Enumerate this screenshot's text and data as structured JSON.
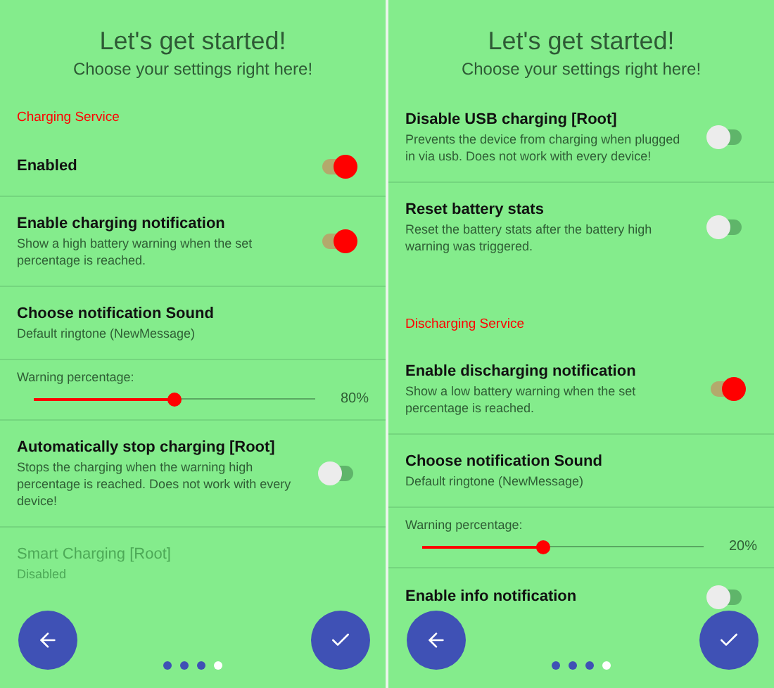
{
  "screens": [
    {
      "title": "Let's get started!",
      "subtitle": "Choose your settings right here!",
      "items": [
        {
          "kind": "header",
          "title": "Charging Service"
        },
        {
          "kind": "switch",
          "title": "Enabled",
          "on": true
        },
        {
          "kind": "switch",
          "title": "Enable charging notification",
          "subtitle": "Show a high battery warning when the set percentage is reached.",
          "on": true
        },
        {
          "kind": "text",
          "title": "Choose notification Sound",
          "subtitle": "Default ringtone (NewMessage)",
          "disabled": false
        },
        {
          "kind": "slider",
          "title": "Warning percentage:",
          "level": 0.5,
          "reading": "80%"
        },
        {
          "kind": "switch",
          "title": "Automatically stop charging [Root]",
          "subtitle": "Stops the charging when the warning high percentage is reached. Does not work with every device!",
          "on": false
        },
        {
          "kind": "text",
          "title": "Smart Charging [Root]",
          "subtitle": "Disabled",
          "disabled": true
        }
      ],
      "dots": [
        {
          "selected": false
        },
        {
          "selected": false
        },
        {
          "selected": false
        },
        {
          "selected": true
        }
      ]
    },
    {
      "title": "Let's get started!",
      "subtitle": "Choose your settings right here!",
      "items": [
        {
          "kind": "switch",
          "title": "Disable USB charging [Root]",
          "subtitle": "Prevents the device from charging when plugged in via usb. Does not work with every device!",
          "on": false
        },
        {
          "kind": "switch",
          "title": "Reset battery stats",
          "subtitle": "Reset the battery stats after the battery high warning was triggered.",
          "on": false
        },
        {
          "kind": "header",
          "title": "Discharging Service"
        },
        {
          "kind": "switch",
          "title": "Enable discharging notification",
          "subtitle": "Show a low battery warning when the set percentage is reached.",
          "on": true
        },
        {
          "kind": "text",
          "title": "Choose notification Sound",
          "subtitle": "Default ringtone (NewMessage)",
          "disabled": false
        },
        {
          "kind": "slider",
          "title": "Warning percentage:",
          "level": 0.43,
          "reading": "20%"
        },
        {
          "kind": "switch",
          "title": "Enable info notification",
          "on": false
        }
      ],
      "dots": [
        {
          "selected": false
        },
        {
          "selected": false
        },
        {
          "selected": false
        },
        {
          "selected": true
        }
      ]
    }
  ]
}
